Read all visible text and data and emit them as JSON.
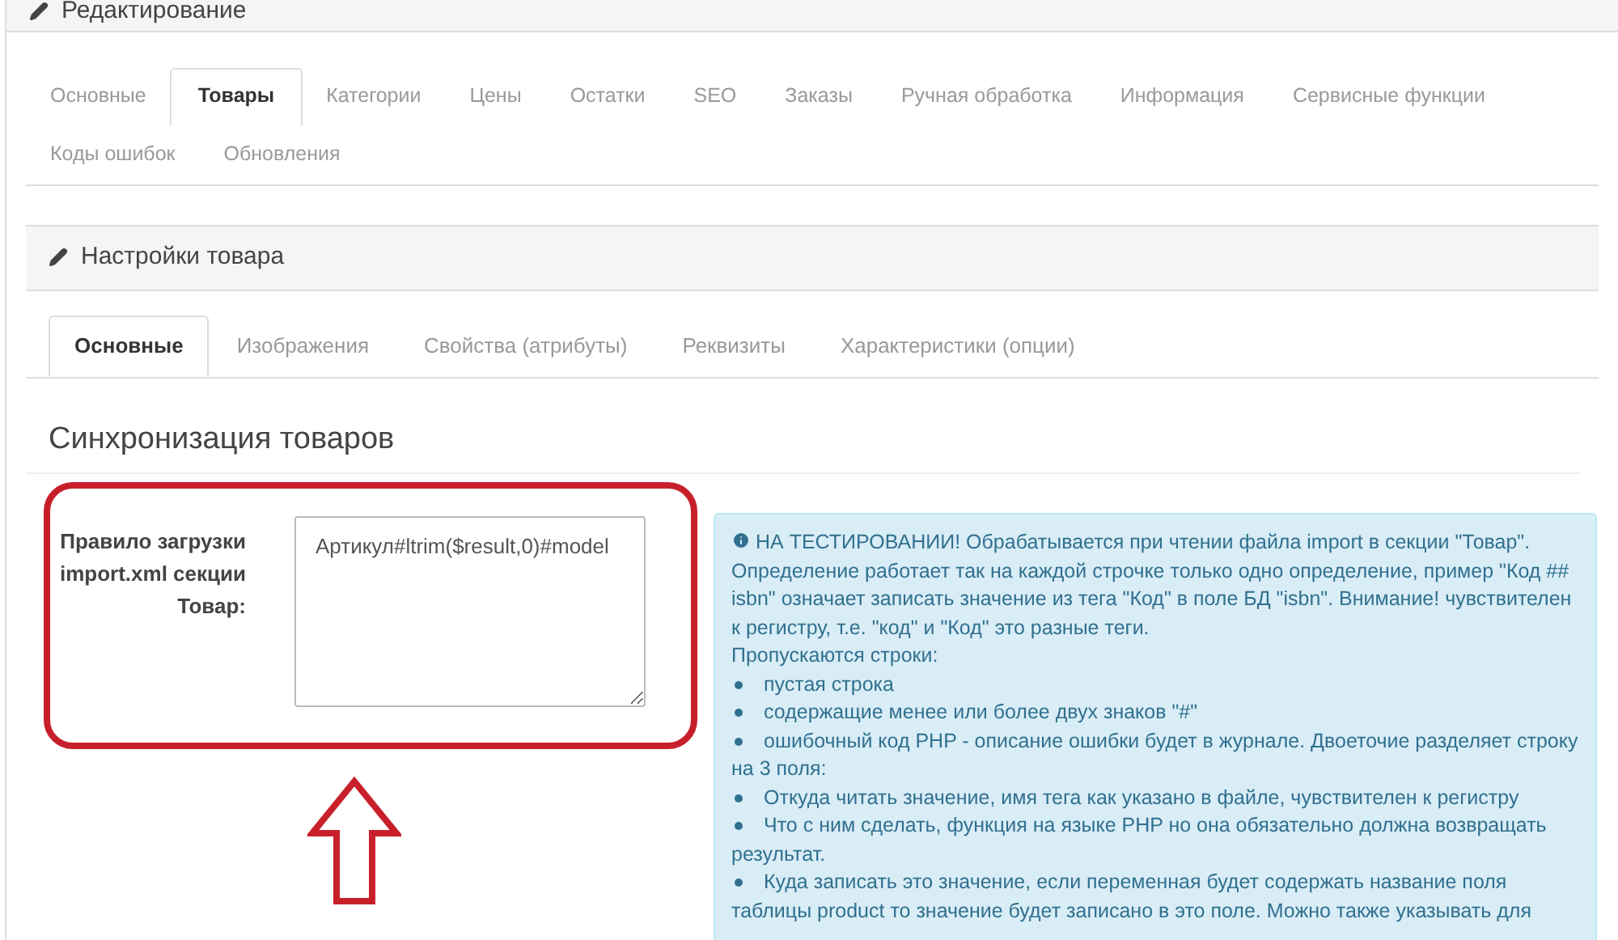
{
  "panel": {
    "title": "Редактирование"
  },
  "tabs": [
    {
      "label": "Основные",
      "selected": false
    },
    {
      "label": "Товары",
      "selected": true
    },
    {
      "label": "Категории",
      "selected": false
    },
    {
      "label": "Цены",
      "selected": false
    },
    {
      "label": "Остатки",
      "selected": false
    },
    {
      "label": "SEO",
      "selected": false
    },
    {
      "label": "Заказы",
      "selected": false
    },
    {
      "label": "Ручная обработка",
      "selected": false
    },
    {
      "label": "Информация",
      "selected": false
    },
    {
      "label": "Сервисные функции",
      "selected": false
    },
    {
      "label": "Коды ошибок",
      "selected": false
    },
    {
      "label": "Обновления",
      "selected": false
    }
  ],
  "subpanel": {
    "title": "Настройки товара"
  },
  "subtabs": [
    {
      "label": "Основные",
      "selected": true
    },
    {
      "label": "Изображения",
      "selected": false
    },
    {
      "label": "Свойства (атрибуты)",
      "selected": false
    },
    {
      "label": "Реквизиты",
      "selected": false
    },
    {
      "label": "Характеристики (опции)",
      "selected": false
    }
  ],
  "section_title": "Синхронизация товаров",
  "field": {
    "label": "Правило загрузки import.xml секции Товар:",
    "value": "Артикул#ltrim($result,0)#model"
  },
  "info": {
    "intro": "НА ТЕСТИРОВАНИИ! Обрабатывается при чтении файла import в секции \"Товар\". Определение работает так на каждой строчке только одно определение, пример \"Код ## isbn\" означает записать значение из тега \"Код\" в поле БД \"isbn\". Внимание! чувствителен к регистру, т.е. \"код\" и \"Код\" это разные теги.",
    "skip_title": "Пропускаются строки:",
    "items": [
      "пустая строка",
      "содержащие менее или более двух знаков \"#\"",
      "ошибочный код PHP - описание ошибки будет в журнале. Двоеточие разделяет строку на 3 поля:",
      "Откуда читать значение, имя тега как указано в файле, чувствителен к регистру",
      "Что с ним сделать, функция на языке PHP но она обязательно должна возвращать результат.",
      "Куда записать это значение, если переменная будет содержать название поля таблицы product то значение будет записано в это поле. Можно также указывать для"
    ]
  }
}
